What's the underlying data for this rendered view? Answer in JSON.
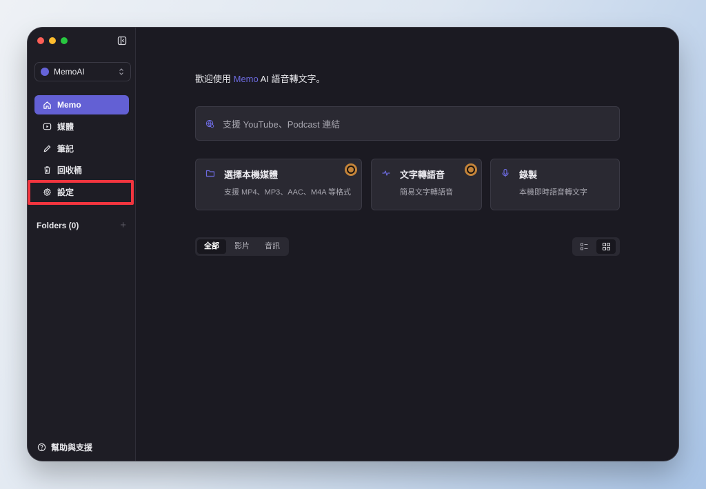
{
  "sidebar": {
    "workspace": {
      "name": "MemoAI",
      "color": "#6563d8"
    },
    "items": [
      {
        "label": "Memo",
        "icon": "home-icon",
        "active": true
      },
      {
        "label": "媒體",
        "icon": "play-square-icon"
      },
      {
        "label": "筆記",
        "icon": "pencil-icon"
      },
      {
        "label": "回收桶",
        "icon": "trash-icon"
      },
      {
        "label": "設定",
        "icon": "gear-icon",
        "highlighted": true
      }
    ],
    "folders_label": "Folders (0)",
    "folders_add": "+",
    "help_label": "幫助與支援"
  },
  "main": {
    "welcome_prefix": "歡迎使用 ",
    "welcome_accent": "Memo",
    "welcome_suffix": " AI 語音轉文字。",
    "link_placeholder": "支援 YouTube、Podcast 連結",
    "cards": [
      {
        "title": "選擇本機媒體",
        "desc": "支援 MP4、MP3、AAC、M4A 等格式",
        "icon": "folder-icon",
        "badge": true
      },
      {
        "title": "文字轉語音",
        "desc": "簡易文字轉語音",
        "icon": "sparkle-icon",
        "badge": true
      },
      {
        "title": "錄製",
        "desc": "本機即時語音轉文字",
        "icon": "microphone-icon",
        "badge": false
      }
    ],
    "filter_tabs": [
      "全部",
      "影片",
      "音訊"
    ],
    "active_filter": "全部",
    "view_modes": [
      "list-view-icon",
      "grid-view-icon"
    ],
    "active_view": "grid-view-icon"
  },
  "colors": {
    "accent": "#6360d4",
    "highlight_border": "#f2353f",
    "badge": "#c4843a"
  }
}
